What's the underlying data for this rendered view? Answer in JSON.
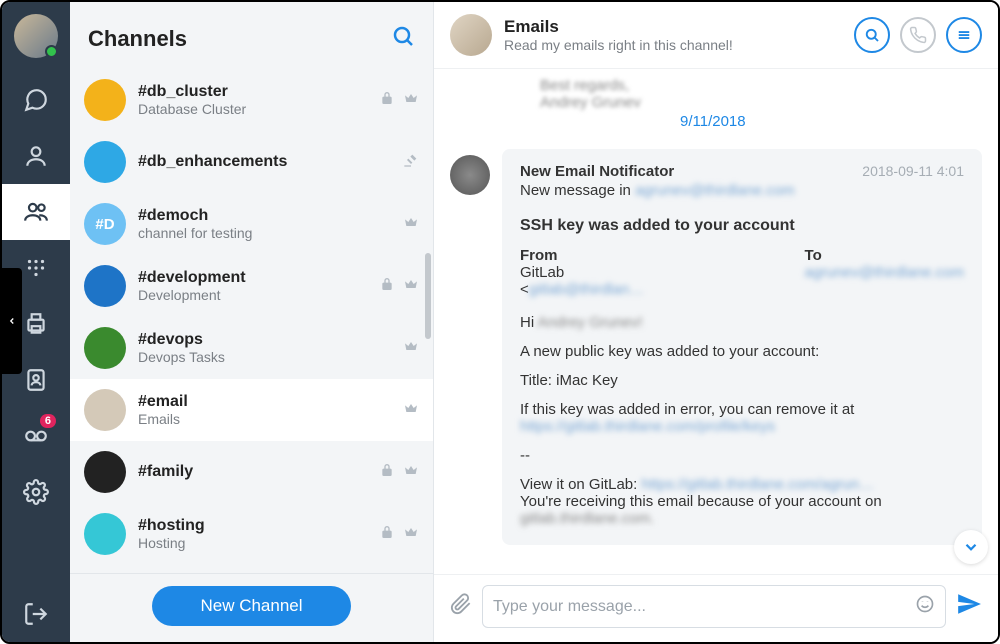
{
  "sidebar": {
    "badge_count": "6"
  },
  "panel": {
    "title": "Channels",
    "items": [
      {
        "name": "#db_cluster",
        "desc": "Database Cluster",
        "avatar_bg": "#f3b21a",
        "avatar_label": "",
        "lock": true,
        "crown": true,
        "gavel": false
      },
      {
        "name": "#db_enhancements",
        "desc": "",
        "avatar_bg": "#2ea8e5",
        "avatar_label": "",
        "lock": false,
        "crown": false,
        "gavel": true
      },
      {
        "name": "#democh",
        "desc": "channel for testing",
        "avatar_bg": "#6ec1f4",
        "avatar_label": "#D",
        "lock": false,
        "crown": true,
        "gavel": false
      },
      {
        "name": "#development",
        "desc": "Development",
        "avatar_bg": "#1e74c7",
        "avatar_label": "",
        "lock": true,
        "crown": true,
        "gavel": false
      },
      {
        "name": "#devops",
        "desc": "Devops Tasks",
        "avatar_bg": "#3a8a2e",
        "avatar_label": "",
        "lock": false,
        "crown": true,
        "gavel": false
      },
      {
        "name": "#email",
        "desc": "Emails",
        "avatar_bg": "#d4c9b8",
        "avatar_label": "",
        "lock": false,
        "crown": true,
        "gavel": false,
        "selected": true
      },
      {
        "name": "#family",
        "desc": "",
        "avatar_bg": "#222",
        "avatar_label": "",
        "lock": true,
        "crown": true,
        "gavel": false
      },
      {
        "name": "#hosting",
        "desc": "Hosting",
        "avatar_bg": "#35c7d6",
        "avatar_label": "",
        "lock": true,
        "crown": true,
        "gavel": false
      }
    ],
    "new_channel_label": "New Channel"
  },
  "chat": {
    "title": "Emails",
    "subtitle": "Read my emails right in this channel!",
    "prev_lines": [
      "Best regards,",
      "Andrey Grunev"
    ],
    "date_separator": "9/11/2018",
    "message": {
      "sender": "New Email Notificator",
      "timestamp": "2018-09-11 4:01",
      "intro_prefix": "New message in ",
      "intro_blur": "agrunev@thirdlane.com",
      "subject": "SSH key was added to your account",
      "from_label": "From",
      "from_value_prefix": "GitLab <",
      "from_value_blur": "gitlab@thirdlan…",
      "to_label": "To",
      "to_value_blur": "agrunev@thirdlane.com",
      "greeting_prefix": "Hi ",
      "greeting_blur": "Andrey Grunev!",
      "p1": "A new public key was added to your account:",
      "p2": "Title: iMac Key",
      "p3": "If this key was added in error, you can remove it at",
      "p3_link_blur": "https://gitlab.thirdlane.com/profile/keys",
      "divider": "--",
      "p4_prefix": "View it on GitLab: ",
      "p4_blur": "https://gitlab.thirdlane.com/agrun…",
      "p5_prefix": "You're receiving this email because of your account on",
      "p5_blur": "gitlab.thirdlane.com."
    },
    "composer_placeholder": "Type your message..."
  }
}
